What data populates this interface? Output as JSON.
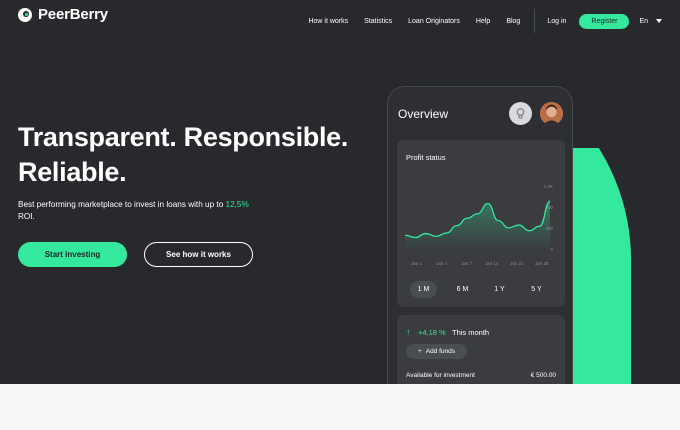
{
  "brand": {
    "name": "PeerBerry"
  },
  "nav": {
    "links": [
      "How it works",
      "Statistics",
      "Loan Originators",
      "Help",
      "Blog"
    ],
    "login": "Log in",
    "register": "Register",
    "language": "En"
  },
  "hero": {
    "headline_line1": "Transparent. Responsible.",
    "headline_line2": "Reliable.",
    "sub_before": "Best performing marketplace to invest in loans with up to ",
    "sub_roi": "12,5%",
    "sub_after": " ROI.",
    "primary_cta": "Start investing",
    "secondary_cta": "See how it works"
  },
  "phone": {
    "title": "Overview",
    "profit_card": {
      "title": "Profit status",
      "y_ticks": [
        "1.2K",
        "800",
        "400",
        "0"
      ],
      "x_ticks": [
        "Jan 1",
        "Jan 4",
        "Jan 7",
        "Jan 14",
        "Jan 21",
        "Jan 28"
      ],
      "periods": [
        "1 M",
        "6 M",
        "1 Y",
        "5 Y"
      ],
      "active_period": "1 M"
    },
    "stats_card": {
      "change": "+4,18 %",
      "change_label": "This month",
      "add_funds": "Add funds",
      "available_label": "Available for investment",
      "available_value": "€ 500.00"
    }
  },
  "colors": {
    "accent": "#34e89e",
    "background": "#27292c",
    "card": "#3a3c40"
  },
  "chart_data": {
    "type": "area",
    "x": [
      "Jan 1",
      "Jan 4",
      "Jan 7",
      "Jan 10",
      "Jan 12",
      "Jan 14",
      "Jan 16",
      "Jan 18",
      "Jan 19",
      "Jan 20",
      "Jan 21",
      "Jan 23",
      "Jan 25",
      "Jan 26",
      "Jan 28"
    ],
    "values": [
      260,
      220,
      290,
      240,
      300,
      430,
      560,
      640,
      820,
      520,
      390,
      440,
      340,
      420,
      860
    ],
    "ylim": [
      0,
      1200
    ],
    "y_ticks": [
      "0",
      "400",
      "800",
      "1.2K"
    ]
  }
}
